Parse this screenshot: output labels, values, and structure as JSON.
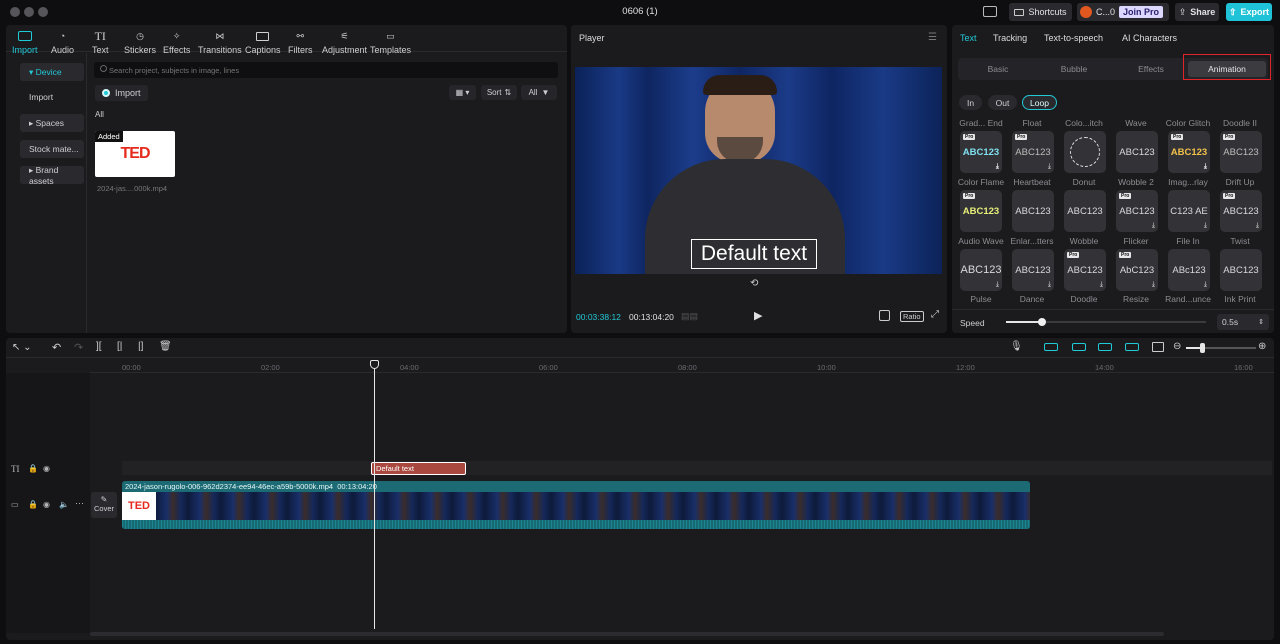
{
  "window": {
    "title": "0606 (1)"
  },
  "titlebar": {
    "shortcuts": "Shortcuts",
    "user": "C...0",
    "join": "Join Pro",
    "share": "Share",
    "export": "Export"
  },
  "toolbar": [
    "Import",
    "Audio",
    "Text",
    "Stickers",
    "Effects",
    "Transitions",
    "Captions",
    "Filters",
    "Adjustment",
    "Templates"
  ],
  "sidebar": [
    "▾ Device",
    "Import",
    "▸ Spaces",
    "Stock mate...",
    "▸ Brand assets"
  ],
  "media": {
    "search_placeholder": "Search project, subjects in image, lines",
    "import": "Import",
    "sort": "Sort",
    "all_btn": "All",
    "all_label": "All",
    "added": "Added",
    "thumb_text": "TED",
    "filename": "2024-jas....000k.mp4"
  },
  "player": {
    "title": "Player",
    "overlay": "Default text",
    "current": "00:03:38:12",
    "total": "00:13:04:20",
    "ratio": "Ratio"
  },
  "right": {
    "tabs": [
      "Text",
      "Tracking",
      "Text-to-speech",
      "AI Characters"
    ],
    "subtabs": [
      "Basic",
      "Bubble",
      "Effects",
      "Animation"
    ],
    "pills": [
      "In",
      "Out",
      "Loop"
    ],
    "speed_label": "Speed",
    "speed_value": "0.5s",
    "speed_pct": 0.18,
    "names": [
      [
        "Grad... End",
        "Float",
        "Colo...itch",
        "Wave",
        "Color Glitch",
        "Doodle II"
      ],
      [
        "Color Flame",
        "Heartbeat",
        "Donut",
        "Wobble 2",
        "Imag...rlay",
        "Drift Up"
      ],
      [
        "Audio Wave",
        "Enlar...tters",
        "Wobble",
        "Flicker",
        "File In",
        "Twist"
      ],
      [
        "Pulse",
        "Dance",
        "Doodle",
        "Resize",
        "Rand...unce",
        "Ink Print"
      ]
    ],
    "cards": [
      [
        "ABC123",
        "ABC123",
        "",
        "ABC123",
        "ABC123",
        "ABC123"
      ],
      [
        "ABC123",
        "ABC123",
        "ABC123",
        "ABC123",
        "C123 AE",
        "ABC123"
      ],
      [
        "ABC123",
        "ABC123",
        "ABC123",
        "AbC123",
        "ABc123",
        "ABC123"
      ]
    ]
  },
  "timeline": {
    "ruler": [
      "00:00",
      "02:00",
      "04:00",
      "06:00",
      "08:00",
      "10:00",
      "12:00",
      "14:00",
      "16:00"
    ],
    "text_clip": "Default text",
    "video_clip": "2024-jason-rugolo-006-962d2374-ee94-46ec-a59b-5000k.mp4",
    "video_duration": "00:13:04:20",
    "cover": "Cover",
    "thumb_text": "TED"
  },
  "colors": {
    "accent": "#22c9d6",
    "highlight": "#e0242a",
    "export": "#1fc2d6",
    "ted_red": "#e62b1e"
  }
}
